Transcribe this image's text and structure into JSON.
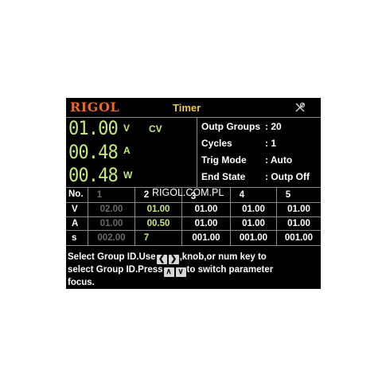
{
  "header": {
    "logo": "RIGOL",
    "title": "Timer"
  },
  "readout": {
    "voltage": "01.00",
    "voltage_unit": "V",
    "current": "00.48",
    "current_unit": "A",
    "power": "00.48",
    "power_unit": "W",
    "mode": "CV"
  },
  "info": {
    "outp_groups_label": "Outp Groups",
    "outp_groups_value": ": 20",
    "cycles_label": "Cycles",
    "cycles_value": ": 1",
    "trig_mode_label": "Trig Mode",
    "trig_mode_value": ": Auto",
    "end_state_label": "End State",
    "end_state_value": ": Outp Off"
  },
  "table": {
    "row_labels": [
      "No.",
      "V",
      "A",
      "s"
    ],
    "groups": [
      {
        "no": "1",
        "v": "02.00",
        "a": "01.00",
        "s": "002.00"
      },
      {
        "no": "2",
        "v": "01.00",
        "a": "00.50",
        "s": "7"
      },
      {
        "no": "3",
        "v": "01.00",
        "a": "01.00",
        "s": "001.00"
      },
      {
        "no": "4",
        "v": "01.00",
        "a": "01.00",
        "s": "001.00"
      },
      {
        "no": "5",
        "v": "01.00",
        "a": "01.00",
        "s": "001.00"
      }
    ]
  },
  "watermark": "RIGOL.COM.PL",
  "help": {
    "line1_a": "Select Group ID.Use",
    "line1_b": ",knob,or num key to",
    "line2_a": "select Group ID.Press",
    "line2_b": "to switch parameter",
    "line3": "focus."
  },
  "icons": {
    "status": "tool-crossed-icon",
    "key_left": "chevron-left-icon",
    "key_right": "chevron-right-icon",
    "key_up": "chevron-up-icon",
    "key_down": "chevron-down-icon"
  },
  "colors": {
    "logo": "#f26522",
    "title": "#e8c84a",
    "readout": "#c7e87a",
    "background": "#000000"
  }
}
